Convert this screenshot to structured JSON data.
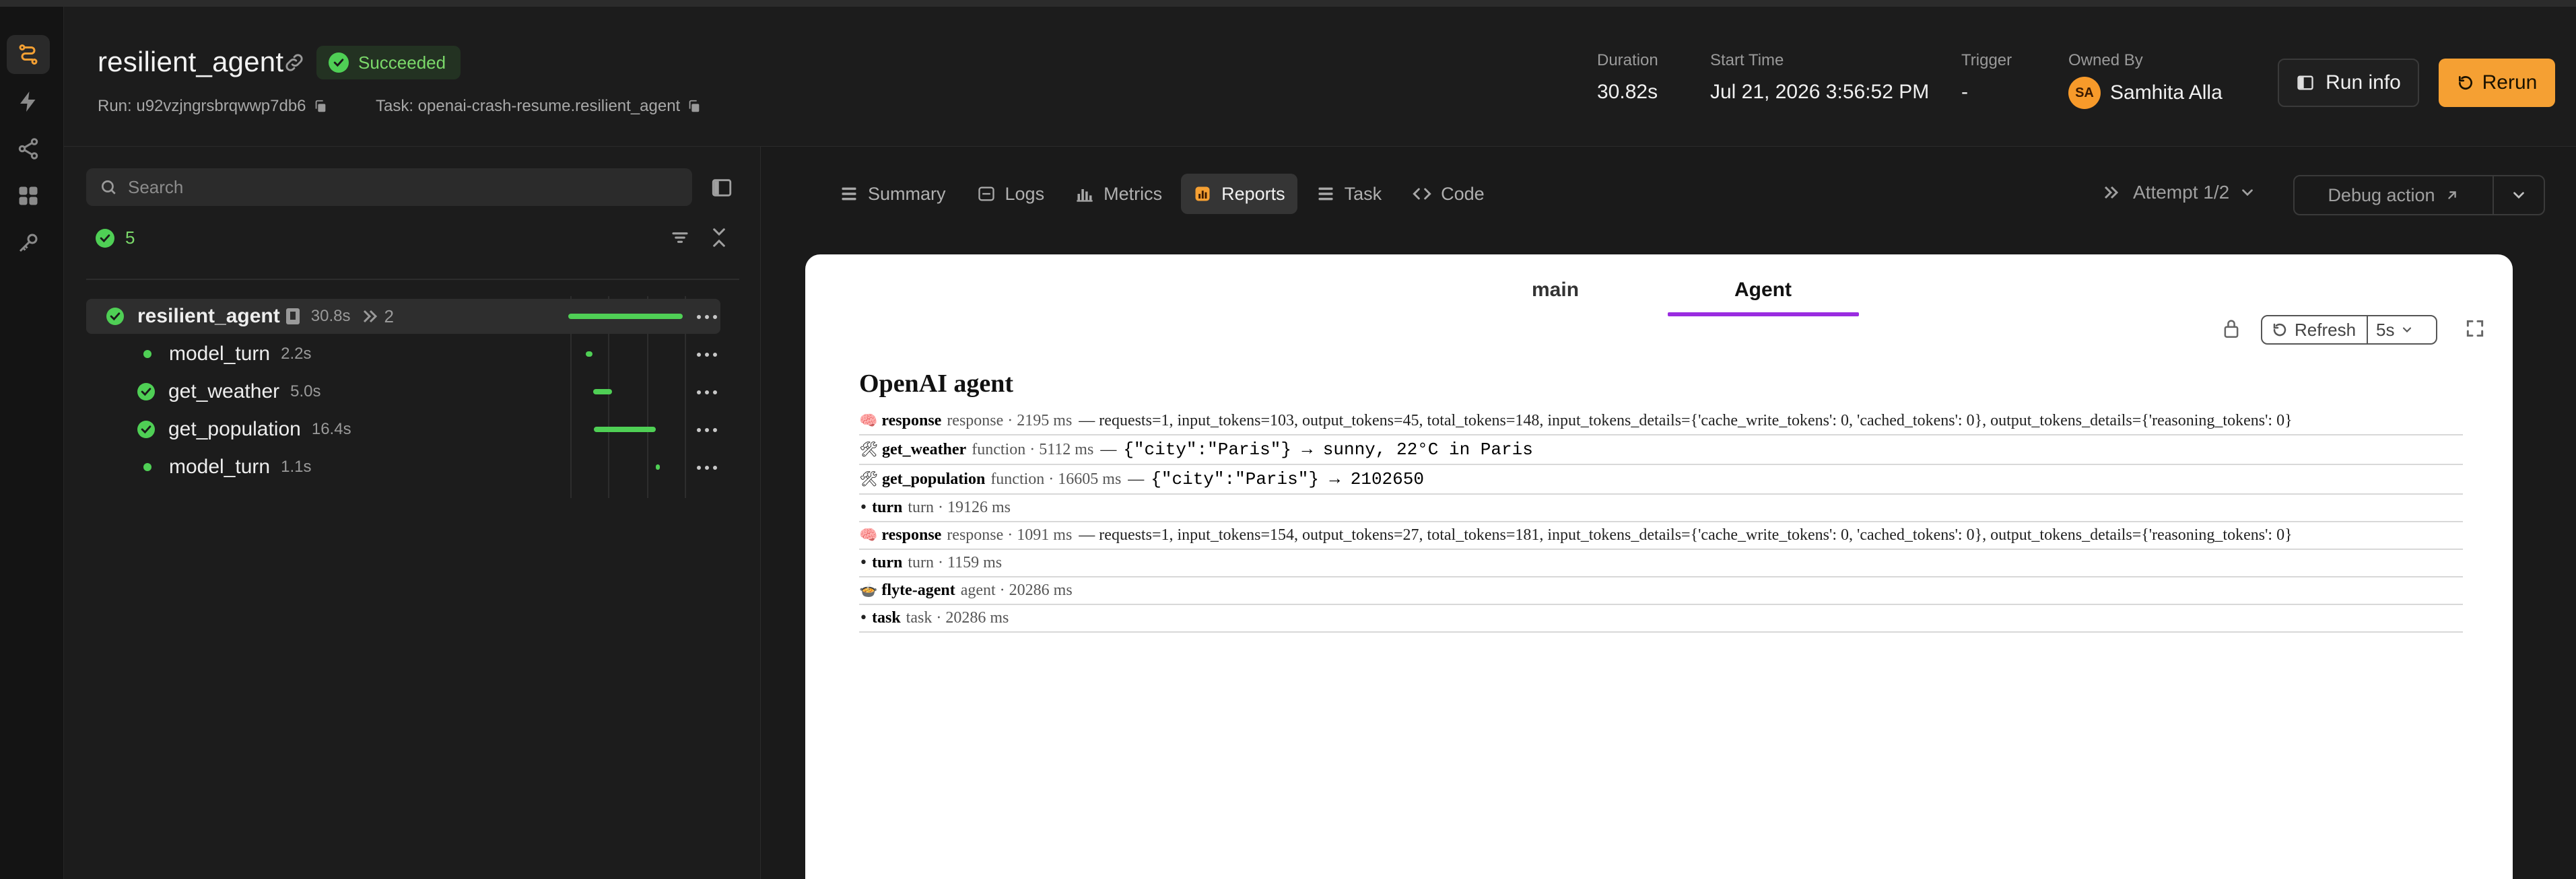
{
  "header": {
    "title": "resilient_agent",
    "status": "Succeeded",
    "run_label": "Run: u92vzjngrsbrqwwp7db6",
    "task_label": "Task: openai-crash-resume.resilient_agent",
    "duration_label": "Duration",
    "duration_value": "30.82s",
    "start_label": "Start Time",
    "start_value": "Jul 21, 2026 3:56:52 PM",
    "trigger_label": "Trigger",
    "trigger_value": "-",
    "owner_label": "Owned By",
    "owner_initials": "SA",
    "owner_name": "Samhita Alla",
    "run_info_button": "Run info",
    "rerun_button": "Rerun"
  },
  "left_panel": {
    "search_placeholder": "Search",
    "success_count": "5",
    "tree": [
      {
        "name": "resilient_agent",
        "duration": "30.8s",
        "attempts": "2",
        "progress": 1.0
      },
      {
        "name": "model_turn",
        "duration": "2.2s",
        "progress": 0.07
      },
      {
        "name": "get_weather",
        "duration": "5.0s",
        "progress": 0.16
      },
      {
        "name": "get_population",
        "duration": "16.4s",
        "progress": 0.53
      },
      {
        "name": "model_turn",
        "duration": "1.1s",
        "progress": 0.04
      }
    ]
  },
  "tabs": [
    "Summary",
    "Logs",
    "Metrics",
    "Reports",
    "Task",
    "Code"
  ],
  "active_tab": "Reports",
  "attempt": "Attempt 1/2",
  "debug_button": "Debug action",
  "report": {
    "tabs": [
      "main",
      "Agent"
    ],
    "active_tab": "Agent",
    "refresh_label": "Refresh",
    "interval": "5s",
    "heading": "OpenAI agent",
    "events": [
      {
        "icon": "🧠",
        "name": "response",
        "meta": "response · 2195 ms",
        "detail": "— requests=1, input_tokens=103, output_tokens=45, total_tokens=148, input_tokens_details={'cache_write_tokens': 0, 'cached_tokens': 0}, output_tokens_details={'reasoning_tokens': 0}",
        "mono": ""
      },
      {
        "icon": "🛠",
        "name": "get_weather",
        "meta": "function · 5112 ms",
        "detail": "—",
        "mono": "{\"city\":\"Paris\"} → sunny, 22°C in Paris"
      },
      {
        "icon": "🛠",
        "name": "get_population",
        "meta": "function · 16605 ms",
        "detail": "—",
        "mono": "{\"city\":\"Paris\"} → 2102650"
      },
      {
        "icon": "•",
        "name": "turn",
        "meta": "turn · 19126 ms",
        "detail": "",
        "mono": ""
      },
      {
        "icon": "🧠",
        "name": "response",
        "meta": "response · 1091 ms",
        "detail": "— requests=1, input_tokens=154, output_tokens=27, total_tokens=181, input_tokens_details={'cache_write_tokens': 0, 'cached_tokens': 0}, output_tokens_details={'reasoning_tokens': 0}",
        "mono": ""
      },
      {
        "icon": "•",
        "name": "turn",
        "meta": "turn · 1159 ms",
        "detail": "",
        "mono": ""
      },
      {
        "icon": "🍲",
        "name": "flyte-agent",
        "meta": "agent · 20286 ms",
        "detail": "",
        "mono": ""
      },
      {
        "icon": "•",
        "name": "task",
        "meta": "task · 20286 ms",
        "detail": "",
        "mono": ""
      }
    ]
  },
  "colors": {
    "accent_orange": "#f5a033",
    "success_green": "#4fcf55",
    "report_tab_underline": "#9a2ce0"
  }
}
